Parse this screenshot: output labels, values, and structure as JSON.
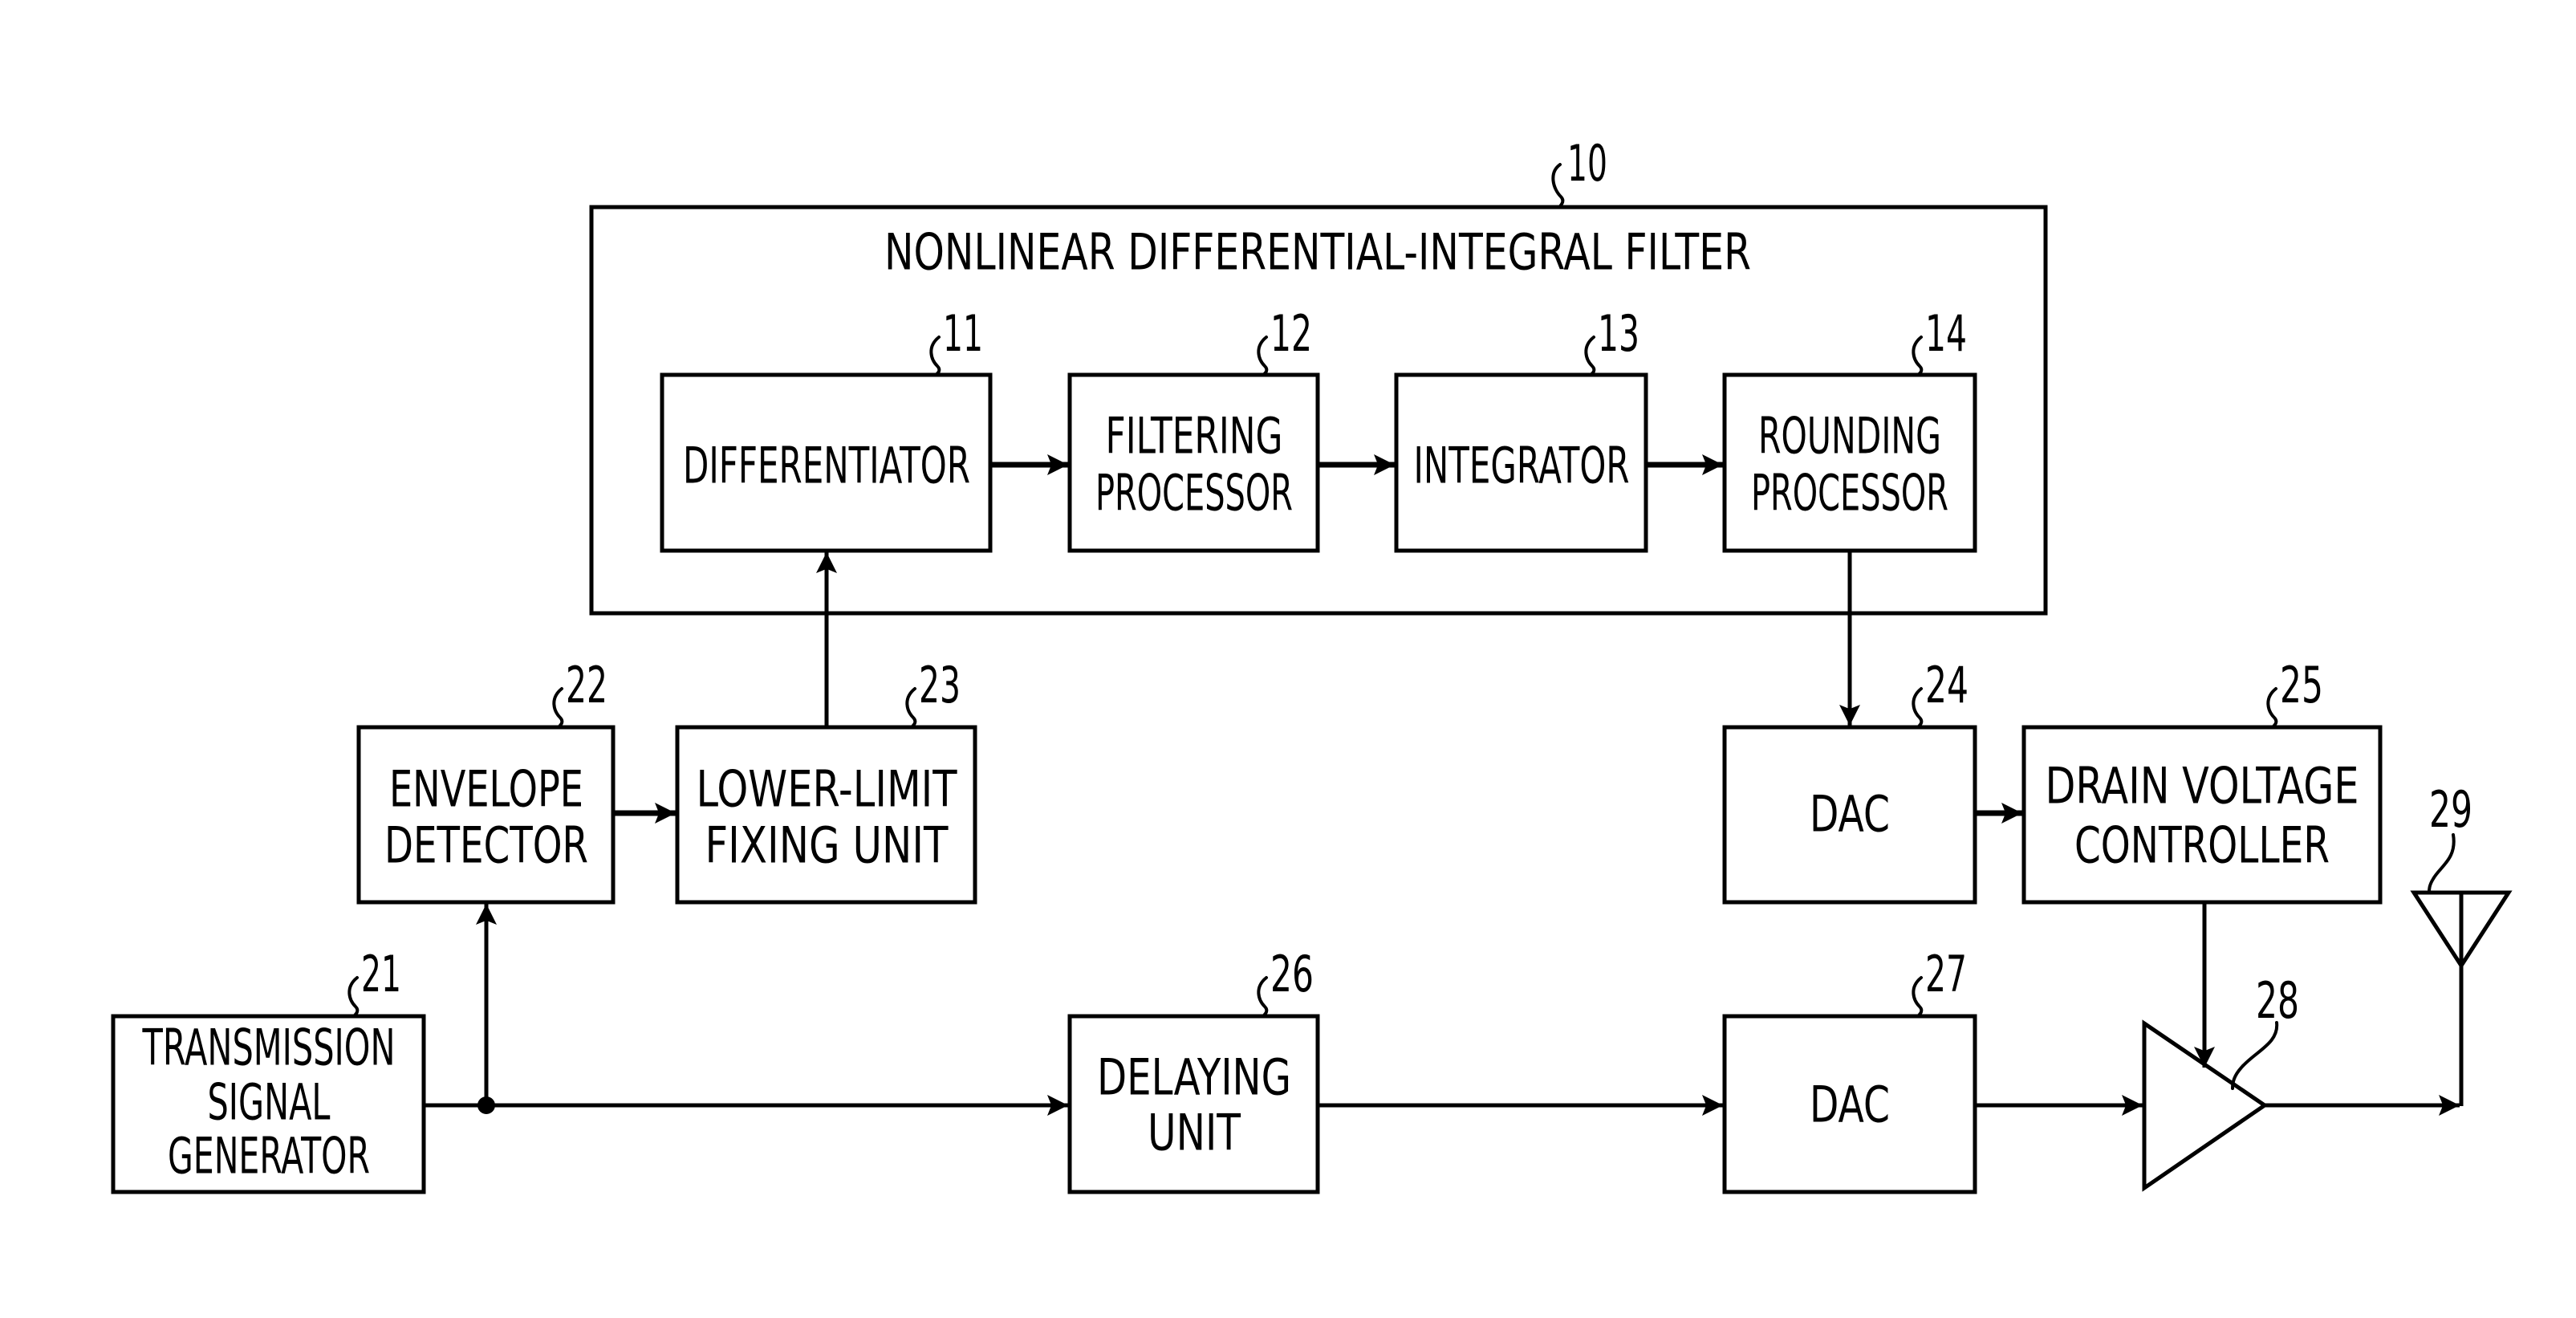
{
  "diagram": {
    "title": "NONLINEAR DIFFERENTIAL-INTEGRAL FILTER",
    "title_ref": "10",
    "blocks": {
      "differentiator": {
        "ref": "11",
        "lines": [
          "DIFFERENTIATOR"
        ]
      },
      "filtering": {
        "ref": "12",
        "lines": [
          "FILTERING",
          "PROCESSOR"
        ]
      },
      "integrator": {
        "ref": "13",
        "lines": [
          "INTEGRATOR"
        ]
      },
      "rounding": {
        "ref": "14",
        "lines": [
          "ROUNDING",
          "PROCESSOR"
        ]
      },
      "transmission": {
        "ref": "21",
        "lines": [
          "TRANSMISSION",
          "SIGNAL",
          "GENERATOR"
        ]
      },
      "envelope": {
        "ref": "22",
        "lines": [
          "ENVELOPE",
          "DETECTOR"
        ]
      },
      "lower_limit": {
        "ref": "23",
        "lines": [
          "LOWER-LIMIT",
          "FIXING UNIT"
        ]
      },
      "dac_top": {
        "ref": "24",
        "lines": [
          "DAC"
        ]
      },
      "drain": {
        "ref": "25",
        "lines": [
          "DRAIN VOLTAGE",
          "CONTROLLER"
        ]
      },
      "delaying": {
        "ref": "26",
        "lines": [
          "DELAYING",
          "UNIT"
        ]
      },
      "dac_bottom": {
        "ref": "27",
        "lines": [
          "DAC"
        ]
      },
      "amplifier": {
        "ref": "28"
      },
      "antenna": {
        "ref": "29"
      }
    },
    "connections": [
      {
        "from": "differentiator",
        "to": "filtering"
      },
      {
        "from": "filtering",
        "to": "integrator"
      },
      {
        "from": "integrator",
        "to": "rounding"
      },
      {
        "from": "rounding",
        "to": "dac_top"
      },
      {
        "from": "dac_top",
        "to": "drain"
      },
      {
        "from": "drain",
        "to": "amplifier"
      },
      {
        "from": "transmission",
        "to": "envelope"
      },
      {
        "from": "envelope",
        "to": "lower_limit"
      },
      {
        "from": "lower_limit",
        "to": "differentiator"
      },
      {
        "from": "transmission",
        "to": "delaying"
      },
      {
        "from": "delaying",
        "to": "dac_bottom"
      },
      {
        "from": "dac_bottom",
        "to": "amplifier"
      },
      {
        "from": "amplifier",
        "to": "antenna"
      }
    ]
  }
}
